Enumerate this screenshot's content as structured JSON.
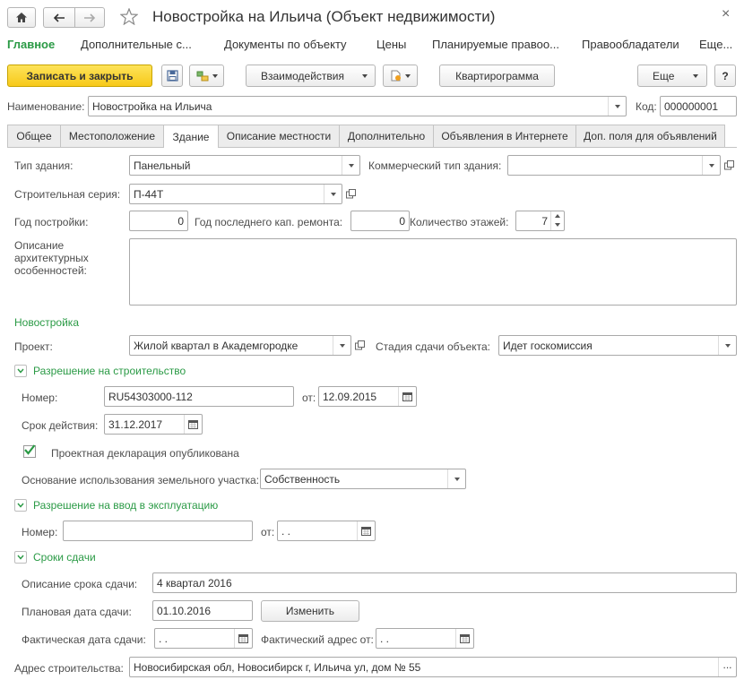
{
  "window": {
    "title": "Новостройка на Ильича (Объект недвижимости)",
    "close_glyph": "×"
  },
  "menu": {
    "items": [
      "Главное",
      "Дополнительные с...",
      "Документы по объекту",
      "Цены",
      "Планируемые правоо...",
      "Правообладатели",
      "Еще..."
    ]
  },
  "toolbar": {
    "save_close": "Записать и закрыть",
    "interactions": "Взаимодействия",
    "apartments": "Квартирограмма",
    "more": "Еще",
    "help": "?"
  },
  "header": {
    "name_label": "Наименование:",
    "name_value": "Новостройка на Ильича",
    "code_label": "Код:",
    "code_value": "000000001"
  },
  "tabs": [
    "Общее",
    "Местоположение",
    "Здание",
    "Описание местности",
    "Дополнительно",
    "Объявления в Интернете",
    "Доп. поля для объявлений"
  ],
  "building": {
    "type_label": "Тип здания:",
    "type_value": "Панельный",
    "commercial_type_label": "Коммерческий тип здания:",
    "commercial_type_value": "",
    "series_label": "Строительная серия:",
    "series_value": "П-44Т",
    "year_label": "Год постройки:",
    "year_value": "0",
    "repair_year_label": "Год последнего кап. ремонта:",
    "repair_year_value": "0",
    "floors_label": "Количество этажей:",
    "floors_value": "7",
    "arch_label": "Описание архитектурных особенностей:",
    "arch_value": ""
  },
  "new_building": {
    "section_title": "Новостройка",
    "project_label": "Проект:",
    "project_value": "Жилой квартал в Академгородке",
    "stage_label": "Стадия сдачи объекта:",
    "stage_value": "Идет госкомиссия"
  },
  "permit": {
    "title": "Разрешение на строительство",
    "number_label": "Номер:",
    "number_value": "RU54303000-112",
    "from_label": "от:",
    "from_value": "12.09.2015",
    "valid_label": "Срок действия:",
    "valid_value": "31.12.2017",
    "declaration_label": "Проектная декларация опубликована",
    "land_label": "Основание использования земельного участка:",
    "land_value": "Собственность"
  },
  "commissioning": {
    "title": "Разрешение на ввод в эксплуатацию",
    "number_label": "Номер:",
    "number_value": "",
    "from_label": "от:",
    "from_value": " .  ."
  },
  "deadlines": {
    "title": "Сроки сдачи",
    "desc_label": "Описание срока сдачи:",
    "desc_value": "4 квартал 2016",
    "planned_label": "Плановая дата сдачи:",
    "planned_value": "01.10.2016",
    "change_button": "Изменить",
    "actual_label": "Фактическая дата сдачи:",
    "actual_value": " .  .",
    "actual_address_label": "Фактический адрес от:",
    "actual_address_value": " .  ."
  },
  "address": {
    "label": "Адрес строительства:",
    "value": "Новосибирская обл, Новосибирск г, Ильича ул, дом № 55",
    "more_glyph": "..."
  },
  "colors": {
    "accent_green": "#2a9a45",
    "primary_button": "#f7c919"
  }
}
